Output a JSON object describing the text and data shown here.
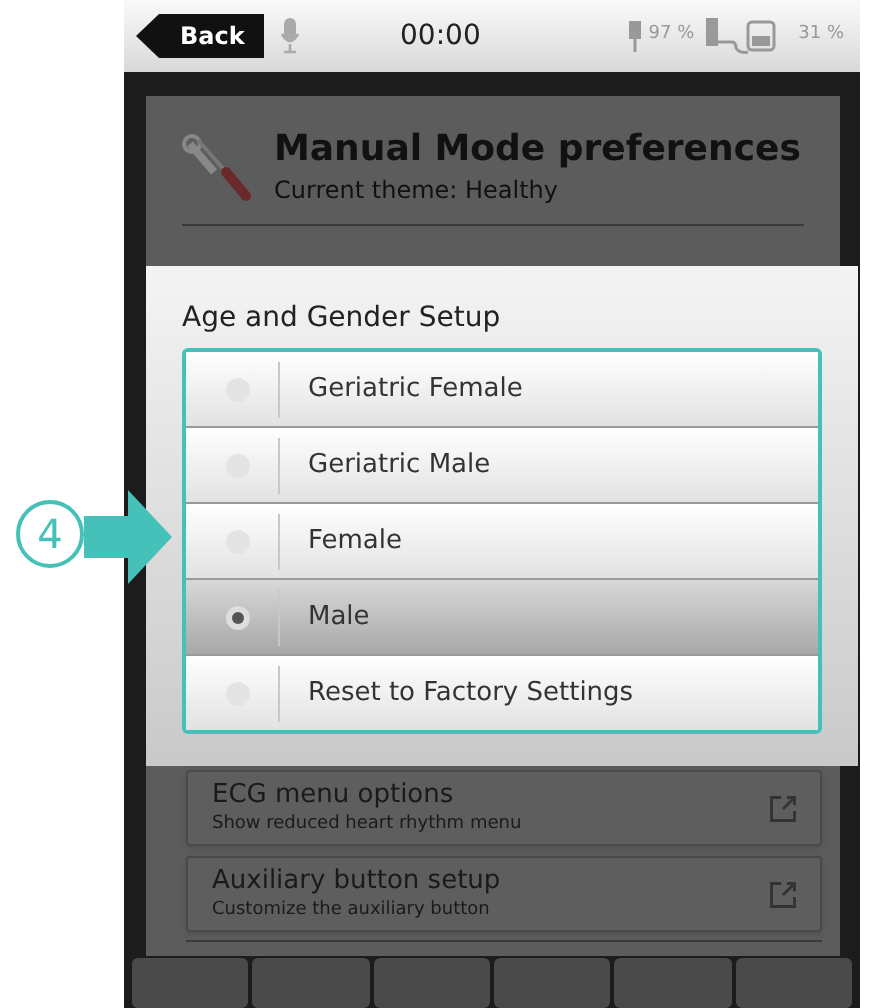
{
  "status_bar": {
    "back": "Back",
    "time": "00:00",
    "battery_1": "97 %",
    "battery_2": "31 %"
  },
  "page": {
    "title": "Manual Mode preferences",
    "subtitle": "Current theme: Healthy",
    "items": [
      {
        "title": "ECG menu options",
        "subtitle": "Show reduced heart rhythm menu"
      },
      {
        "title": "Auxiliary button setup",
        "subtitle": "Customize the auxiliary button"
      }
    ]
  },
  "dialog": {
    "title": "Age and Gender Setup",
    "options": [
      {
        "label": "Geriatric Female",
        "selected": false
      },
      {
        "label": "Geriatric Male",
        "selected": false
      },
      {
        "label": "Female",
        "selected": false
      },
      {
        "label": "Male",
        "selected": true
      },
      {
        "label": "Reset to Factory Settings",
        "selected": false
      }
    ]
  },
  "callout": "4"
}
